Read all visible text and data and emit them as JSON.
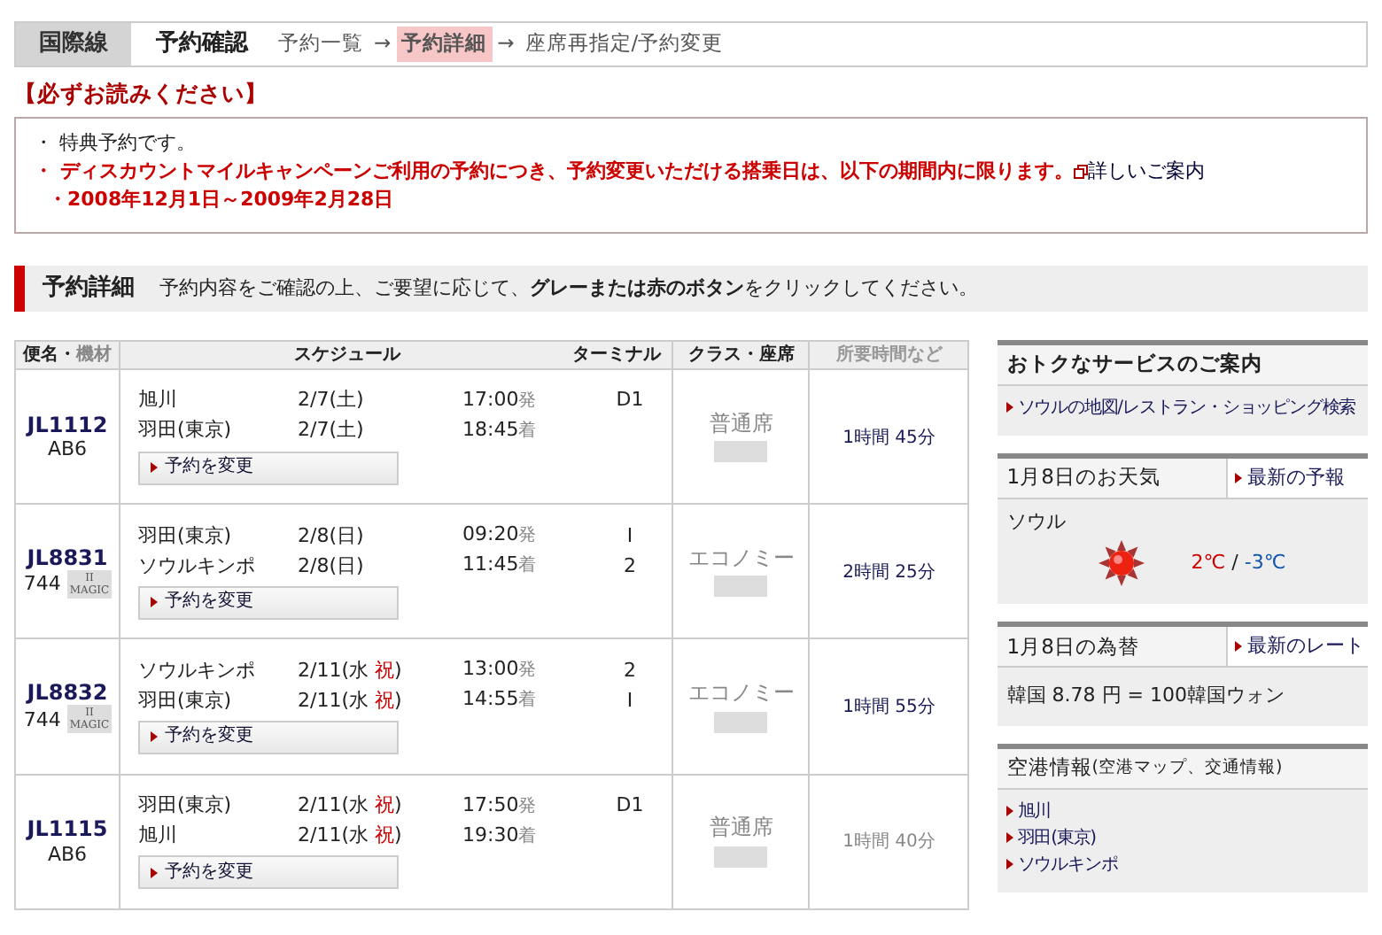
{
  "topbar": {
    "category": "国際線",
    "title": "予約確認",
    "steps": [
      {
        "label": "予約一覧",
        "selected": false
      },
      {
        "label": "予約詳細",
        "selected": true
      },
      {
        "label": "座席再指定/予約変更",
        "selected": false
      }
    ],
    "arrow": "→"
  },
  "notice": {
    "title": "【必ずお読みください】",
    "items": [
      {
        "kind": "plain",
        "text": "・ 特典予約です。"
      },
      {
        "kind": "alert",
        "text": "・ ディスカウントマイルキャンペーンご利用の予約につき、予約変更いただける搭乗日は、以下の期間内に限ります。",
        "link": "詳しいご案内",
        "sub": "・2008年12月1日～2009年2月28日"
      }
    ]
  },
  "section": {
    "title": "予約詳細",
    "text": "予約内容をご確認の上、ご要望に応じて、**グレーまたは赤のボタン**をクリックしてください。"
  },
  "table": {
    "columns": [
      {
        "label": "便名・",
        "extra": "機材"
      },
      {
        "label": "スケジュール",
        "extra": "ターミナル"
      },
      {
        "label": "クラス・座席"
      },
      {
        "label": "所要時間など"
      }
    ],
    "rows": [
      {
        "flight": "JL1112",
        "aircraft": "AB6",
        "badge": null,
        "legs": [
          {
            "city": "旭川",
            "date": [
              {
                "text": "2/7(土)",
                "holiday": false
              }
            ],
            "time": "17:00",
            "suffix": "発",
            "terminal": "D1"
          },
          {
            "city": "羽田(東京)",
            "date": [
              {
                "text": "2/7(土)",
                "holiday": false
              }
            ],
            "time": "18:45",
            "suffix": "着"
          }
        ],
        "button": "予約を変更",
        "seat_class": "普通席",
        "duration": "1時間 45分",
        "muted": false
      },
      {
        "flight": "JL8831",
        "aircraft": "744",
        "badge": {
          "top": "II",
          "bottom": "MAGIC"
        },
        "legs": [
          {
            "city": "羽田(東京)",
            "date": [
              {
                "text": "2/8(日)",
                "holiday": false
              }
            ],
            "time": "09:20",
            "suffix": "発",
            "terminal": "I"
          },
          {
            "city": "ソウルキンポ",
            "date": [
              {
                "text": "2/8(日)",
                "holiday": false
              }
            ],
            "time": "11:45",
            "suffix": "着",
            "terminal": "2"
          }
        ],
        "button": "予約を変更",
        "seat_class": "エコノミー",
        "duration": "2時間 25分",
        "muted": false
      },
      {
        "flight": "JL8832",
        "aircraft": "744",
        "badge": {
          "top": "II",
          "bottom": "MAGIC"
        },
        "legs": [
          {
            "city": "ソウルキンポ",
            "date": [
              {
                "text": "2/11(水 ",
                "holiday": false
              },
              {
                "text": "祝",
                "holiday": true
              },
              {
                "text": ")",
                "holiday": false
              }
            ],
            "time": "13:00",
            "suffix": "発",
            "terminal": "2"
          },
          {
            "city": "羽田(東京)",
            "date": [
              {
                "text": "2/11(水 ",
                "holiday": false
              },
              {
                "text": "祝",
                "holiday": true
              },
              {
                "text": ")",
                "holiday": false
              }
            ],
            "time": "14:55",
            "suffix": "着",
            "terminal": "I"
          }
        ],
        "button": "予約を変更",
        "seat_class": "エコノミー",
        "duration": "1時間 55分",
        "muted": false
      },
      {
        "flight": "JL1115",
        "aircraft": "AB6",
        "badge": null,
        "legs": [
          {
            "city": "羽田(東京)",
            "date": [
              {
                "text": "2/11(水 ",
                "holiday": false
              },
              {
                "text": "祝",
                "holiday": true
              },
              {
                "text": ")",
                "holiday": false
              }
            ],
            "time": "17:50",
            "suffix": "発",
            "terminal": "D1"
          },
          {
            "city": "旭川",
            "date": [
              {
                "text": "2/11(水 ",
                "holiday": false
              },
              {
                "text": "祝",
                "holiday": true
              },
              {
                "text": ")",
                "holiday": false
              }
            ],
            "time": "19:30",
            "suffix": "着"
          }
        ],
        "button": "予約を変更",
        "seat_class": "普通席",
        "duration": "1時間 40分",
        "muted": true
      }
    ]
  },
  "sidebar": [
    {
      "kind": "links",
      "title": "おトクなサービスのご案内",
      "links": [
        "ソウルの地図/レストラン・ショッピング検索"
      ]
    },
    {
      "kind": "weather",
      "title": "1月8日のお天気",
      "action": "最新の予報",
      "city": "ソウル",
      "high": "2℃",
      "sep": "/",
      "low": "-3℃"
    },
    {
      "kind": "rate",
      "title": "1月8日の為替",
      "action": "最新のレート",
      "text": "韓国 8.78 円 = 100韓国ウォン"
    },
    {
      "kind": "links",
      "title": "空港情報",
      "subtitle": "(空港マップ、交通情報)",
      "links": [
        "旭川",
        "羽田(東京)",
        "ソウルキンポ"
      ]
    }
  ]
}
